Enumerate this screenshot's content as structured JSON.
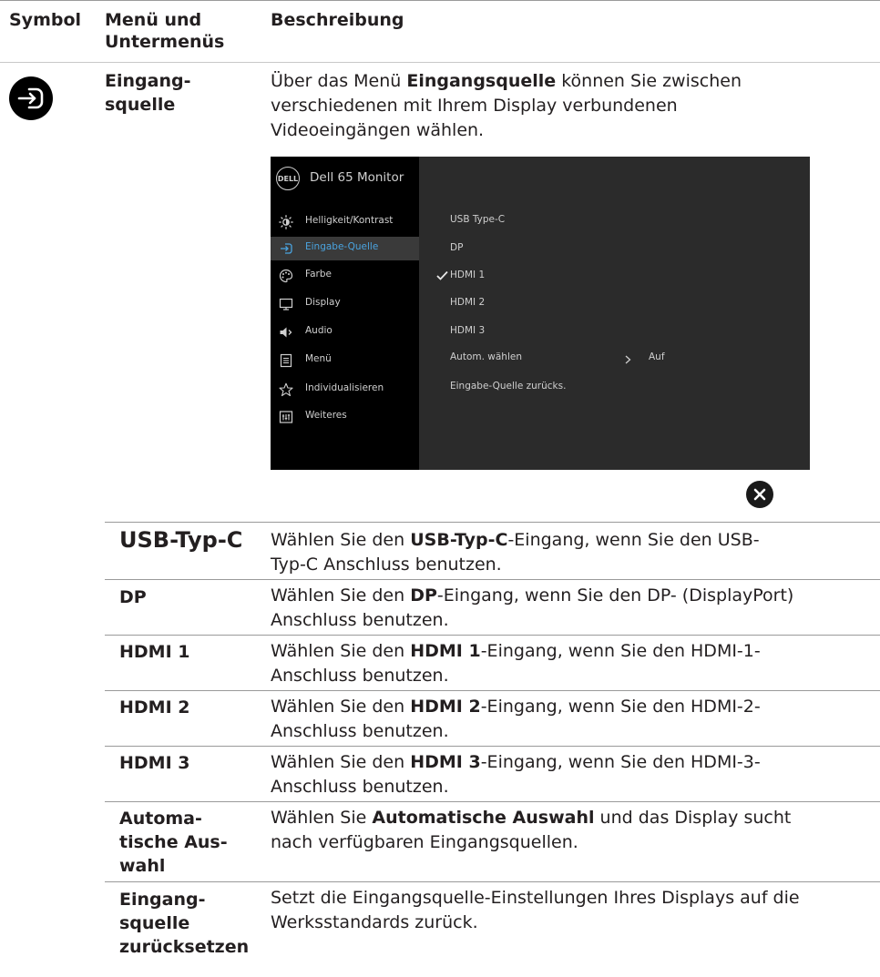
{
  "header": {
    "col_symbol": "Symbol",
    "col_menu_line1": "Menü und",
    "col_menu_line2": "Untermenüs",
    "col_desc": "Beschreibung"
  },
  "section": {
    "name_line1": "Eingang-",
    "name_line2": "squelle",
    "desc_line1_pre": "Über das Menü ",
    "desc_line1_bold": "Eingangsquelle",
    "desc_line1_post": " können Sie zwischen",
    "desc_line2": "verschiedenen mit Ihrem Display verbundenen",
    "desc_line3": "Videoeingängen wählen."
  },
  "osd": {
    "title": "Dell 65 Monitor",
    "logo": "DELL",
    "menu": [
      {
        "label": "Helligkeit/Kontrast",
        "icon": "brightness-icon"
      },
      {
        "label": "Eingabe-Quelle",
        "icon": "input-source-icon",
        "active": true
      },
      {
        "label": "Farbe",
        "icon": "color-palette-icon"
      },
      {
        "label": "Display",
        "icon": "display-icon"
      },
      {
        "label": "Audio",
        "icon": "speaker-icon"
      },
      {
        "label": "Menü",
        "icon": "menu-icon"
      },
      {
        "label": "Individualisieren",
        "icon": "star-icon"
      },
      {
        "label": "Weiteres",
        "icon": "others-icon"
      }
    ],
    "options": [
      {
        "label": "USB Type-C"
      },
      {
        "label": "DP"
      },
      {
        "label": "HDMI 1",
        "checked": true
      },
      {
        "label": "HDMI 2"
      },
      {
        "label": "HDMI 3"
      },
      {
        "label": "Autom. wählen",
        "value": "Auf"
      },
      {
        "label": "Eingabe-Quelle zurücks."
      }
    ]
  },
  "rows": [
    {
      "term": "USB-Typ-C",
      "d1_pre": "Wählen Sie den ",
      "d1_bold": "USB-Typ-C",
      "d1_post": "-Eingang, wenn Sie den USB-",
      "d2": "Typ-C Anschluss benutzen."
    },
    {
      "term": "DP",
      "d1_pre": "Wählen Sie den ",
      "d1_bold": "DP",
      "d1_post": "-Eingang, wenn Sie den DP- (DisplayPort)",
      "d2": "Anschluss benutzen."
    },
    {
      "term": "HDMI 1",
      "d1_pre": "Wählen Sie den ",
      "d1_bold": "HDMI 1",
      "d1_post": "-Eingang, wenn Sie den HDMI-1-",
      "d2": "Anschluss benutzen."
    },
    {
      "term": "HDMI 2",
      "d1_pre": "Wählen Sie den ",
      "d1_bold": "HDMI 2",
      "d1_post": "-Eingang, wenn Sie den HDMI-2-",
      "d2": "Anschluss benutzen."
    },
    {
      "term": "HDMI 3",
      "d1_pre": "Wählen Sie den ",
      "d1_bold": "HDMI 3",
      "d1_post": "-Eingang, wenn Sie den HDMI-3-",
      "d2": "Anschluss benutzen."
    }
  ],
  "auto_row": {
    "term1": "Automa-",
    "term2": "tische Aus-",
    "term3": "wahl",
    "d1_pre": "Wählen Sie ",
    "d1_bold": "Automatische Auswahl",
    "d1_post": " und das Display sucht",
    "d2": "nach verfügbaren Eingangsquellen."
  },
  "reset_row": {
    "term1": "Eingang-",
    "term2": "squelle",
    "term3": "zurücksetzen",
    "d1": "Setzt die Eingangsquelle-Einstellungen Ihres Displays auf die",
    "d2": "Werksstandards zurück."
  }
}
